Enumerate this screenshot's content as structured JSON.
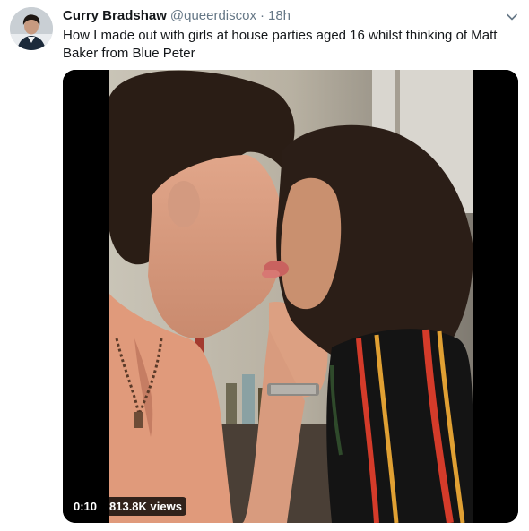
{
  "tweet": {
    "author": {
      "display_name": "Curry Bradshaw",
      "handle": "@queerdiscox",
      "separator": "·",
      "timestamp": "18h",
      "avatar_icon": "profile-photo"
    },
    "menu_icon": "chevron-down-icon",
    "text": "How I made out with girls at house parties aged 16 whilst thinking of Matt Baker from Blue Peter",
    "media": {
      "type": "video",
      "duration": "0:10",
      "views": "813.8K views"
    }
  },
  "colors": {
    "text_primary": "#14171a",
    "text_secondary": "#657786",
    "media_background": "#000000",
    "badge_background": "rgba(0,0,0,0.78)"
  }
}
